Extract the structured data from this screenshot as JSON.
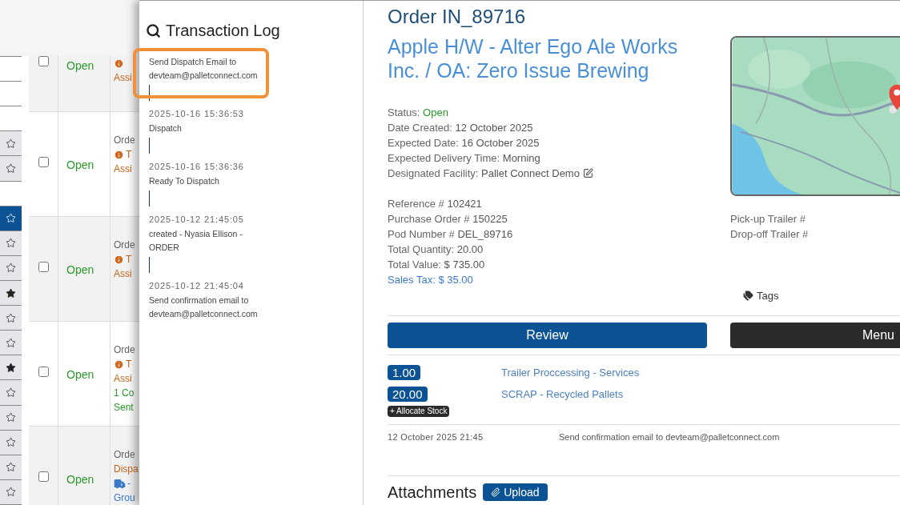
{
  "background_list": {
    "favorites": [
      {
        "kind": "blank"
      },
      {
        "kind": "blank"
      },
      {
        "kind": "blank"
      },
      {
        "kind": "star",
        "filled": false,
        "selected": false
      },
      {
        "kind": "star",
        "filled": false,
        "selected": false
      },
      {
        "kind": "blank"
      },
      {
        "kind": "star",
        "filled": false,
        "selected": true
      },
      {
        "kind": "star",
        "filled": false,
        "selected": false
      },
      {
        "kind": "star",
        "filled": false,
        "selected": false
      },
      {
        "kind": "star",
        "filled": true,
        "selected": false
      },
      {
        "kind": "star",
        "filled": false,
        "selected": false
      },
      {
        "kind": "star",
        "filled": false,
        "selected": false
      },
      {
        "kind": "star",
        "filled": true,
        "selected": false
      },
      {
        "kind": "star",
        "filled": false,
        "selected": false
      },
      {
        "kind": "star",
        "filled": false,
        "selected": false
      },
      {
        "kind": "star",
        "filled": false,
        "selected": false
      },
      {
        "kind": "star",
        "filled": false,
        "selected": false
      },
      {
        "kind": "star",
        "filled": false,
        "selected": false
      }
    ],
    "rows": [
      {
        "checked": false,
        "status": "Open",
        "lines": [
          {
            "kind": "warning"
          },
          {
            "kind": "orange",
            "text": "Assi"
          }
        ]
      },
      {
        "checked": false,
        "status": "Open",
        "lines": [
          {
            "kind": "plain",
            "text": "Orde"
          },
          {
            "kind": "warning",
            "text": "T"
          },
          {
            "kind": "orange",
            "text": "Assi"
          }
        ]
      },
      {
        "checked": false,
        "status": "Open",
        "lines": [
          {
            "kind": "plain",
            "text": "Orde"
          },
          {
            "kind": "warning",
            "text": "T"
          },
          {
            "kind": "orange",
            "text": "Assi"
          }
        ]
      },
      {
        "checked": false,
        "status": "Open",
        "lines": [
          {
            "kind": "plain",
            "text": "Orde"
          },
          {
            "kind": "warning",
            "text": "T"
          },
          {
            "kind": "orange",
            "text": "Assi"
          },
          {
            "kind": "green",
            "text": "1 Co"
          },
          {
            "kind": "green",
            "text": "Sent"
          }
        ]
      },
      {
        "checked": false,
        "status": "Open",
        "lines": [
          {
            "kind": "plain",
            "text": "Orde"
          },
          {
            "kind": "orange",
            "text": "Dispa"
          },
          {
            "kind": "truck",
            "text": "-"
          },
          {
            "kind": "blue",
            "text": "Grou"
          }
        ]
      }
    ]
  },
  "transaction_log": {
    "title": "Transaction Log",
    "entries": [
      {
        "message": "Send Dispatch Email to devteam@palletconnect.com"
      },
      {
        "time": "2025-10-16 15:36:53",
        "message": "Dispatch"
      },
      {
        "time": "2025-10-16 15:36:36",
        "message": "Ready To Dispatch"
      },
      {
        "time": "2025-10-12 21:45:05",
        "message": "created - Nyasia Ellison - ORDER"
      },
      {
        "time": "2025-10-12 21:45:04",
        "message": "Send confirmation email to devteam@palletconnect.com"
      }
    ]
  },
  "order": {
    "title": "Order IN_89716",
    "customer": "Apple H/W - Alter Ego Ale Works Inc. / OA: Zero Issue Brewing",
    "details": [
      [
        {
          "kind": "status",
          "label": "Status:",
          "value": "Open"
        },
        {
          "kind": "plain",
          "label": "Date Created:",
          "value": "12 October 2025"
        },
        {
          "kind": "plain",
          "label": "Expected Date:",
          "value": "16 October 2025"
        },
        {
          "kind": "plain",
          "label": "Expected Delivery Time:",
          "value": "Morning"
        },
        {
          "kind": "editable",
          "label": "Designated Facility:",
          "value": "Pallet Connect Demo"
        }
      ],
      [
        {
          "kind": "plain",
          "label": "Reference #",
          "value": "102421"
        },
        {
          "kind": "plain",
          "label": "Purchase Order #",
          "value": "150225"
        },
        {
          "kind": "plain",
          "label": "Pod Number #",
          "value": "DEL_89716"
        },
        {
          "kind": "plain",
          "label": "Total Quantity:",
          "value": "20.00"
        },
        {
          "kind": "plain",
          "label": "Total Value:",
          "value": "$ 735.00"
        },
        {
          "kind": "link",
          "label": "Sales Tax:",
          "value": "$ 35.00"
        }
      ]
    ],
    "trailers": [
      "Pick-up Trailer #",
      "Drop-off Trailer #"
    ],
    "tags_label": "Tags",
    "buttons": [
      {
        "kind": "primary",
        "label": "Review"
      },
      {
        "kind": "dark",
        "label": "Menu"
      }
    ],
    "items": [
      {
        "quantity": "1.00",
        "name": "Trailer Proccessing - Services"
      },
      {
        "quantity": "20.00",
        "name": "SCRAP - Recycled Pallets"
      }
    ],
    "allocate_label": "+ Allocate Stock",
    "log": [
      {
        "time": "12 October 2025 21:45",
        "message": "Send confirmation email to devteam@palletconnect.com"
      }
    ],
    "attachments": {
      "title": "Attachments",
      "button": "Upload"
    }
  }
}
